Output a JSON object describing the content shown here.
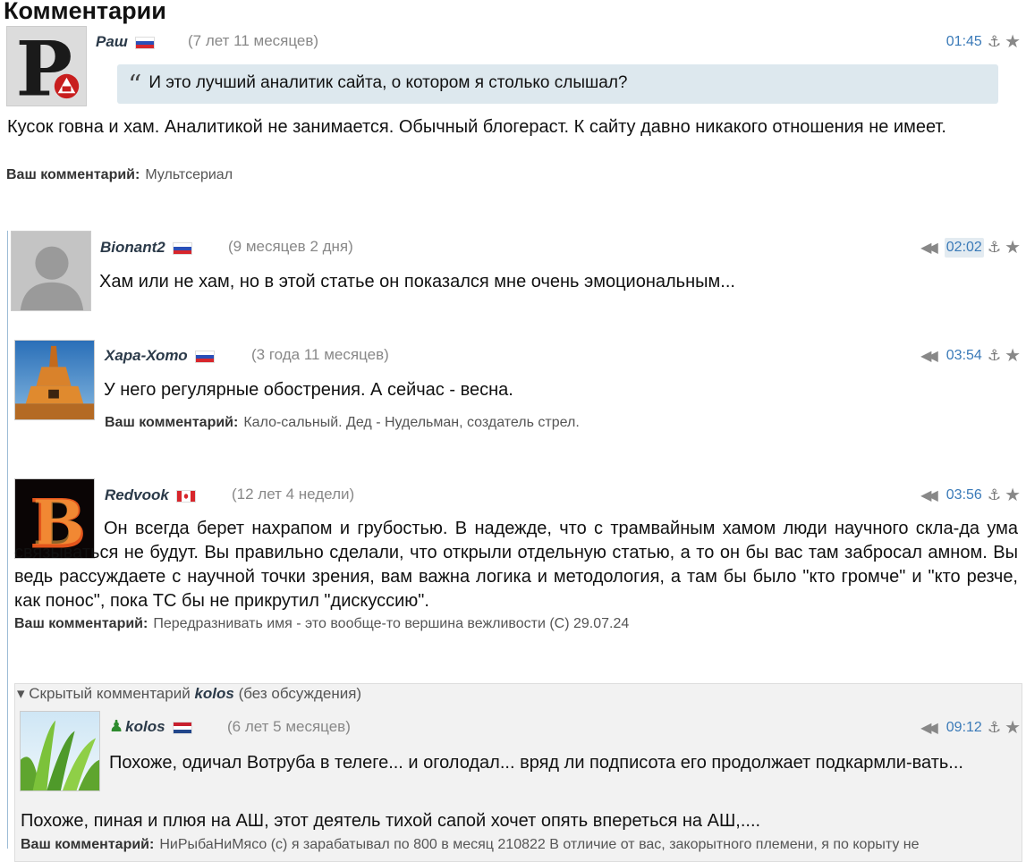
{
  "page": {
    "heading": "Комментарии"
  },
  "comments": [
    {
      "author": "Раш",
      "age": "(7 лет 11 месяцев)",
      "time": "01:45",
      "quote": "И это лучший аналитик сайта, о котором я столько слышал?",
      "text": "Кусок говна и хам. Аналитикой не занимается. Обычный блогераст. К сайту давно никакого отношения не имеет.",
      "sig_label": "Ваш комментарий:",
      "sig_text": "Мультсериал",
      "flag": "russia-flag"
    },
    {
      "author": "Bionant2",
      "age": "(9 месяцев 2 дня)",
      "time": "02:02",
      "text": "Хам или не хам, но в этой статье он показался мне очень эмоциональным...",
      "flag": "russia-flag"
    },
    {
      "author": "Хара-Хото",
      "age": "(3 года 11 месяцев)",
      "time": "03:54",
      "text": "У него регулярные обострения. А сейчас - весна.",
      "sig_label": "Ваш комментарий:",
      "sig_text": "Кало-сальный. Дед - Нудельман, создатель стрел.",
      "flag": "russia-flag"
    },
    {
      "author": "Redvook",
      "age": "(12 лет 4 недели)",
      "time": "03:56",
      "text": "Он всегда берет нахрапом и грубостью. В надежде, что с трамвайным хамом люди научного скла-да ума связываться не будут. Вы правильно сделали, что открыли отдельную статью, а то он бы вас там забросал амном. Вы ведь рассуждаете с научной точки зрения, вам важна логика и методология, а там бы было \"кто громче\" и \"кто резче, как понос\", пока ТС бы не прикрутил \"дискуссию\".",
      "sig_label": "Ваш комментарий:",
      "sig_text": "Передразнивать имя - это вообще-то вершина вежливости (С) 29.07.24",
      "flag": "canada-flag"
    }
  ],
  "hidden": {
    "summary_prefix": "Скрытый комментарий",
    "summary_name": "kolos",
    "summary_suffix": "(без обсуждения)",
    "author": "kolos",
    "age": "(6 лет 5 месяцев)",
    "time": "09:12",
    "text": "Похоже, одичал Вотруба в телеге...  и оголодал...  вряд ли подписота его продолжает подкармли-вать...",
    "text2": "Похоже, пиная и плюя на АШ, этот деятель тихой сапой хочет опять впереться на АШ,....",
    "sig_label": "Ваш комментарий:",
    "sig_text": "НиРыбаНиМясо (с) я зарабатывал по 800 в месяц 210822 В отличие от вас, закорытного племени, я по корыту не",
    "flag": "netherlands-flag"
  },
  "icons": {
    "anchor": "⚓",
    "star": "★",
    "reply": "◀◀",
    "quote": "“",
    "collapse": "▾",
    "user": "♟"
  },
  "colors": {
    "link": "#3a7ab8",
    "quote_bg": "#dde8ee",
    "author": "#2b3a49"
  }
}
